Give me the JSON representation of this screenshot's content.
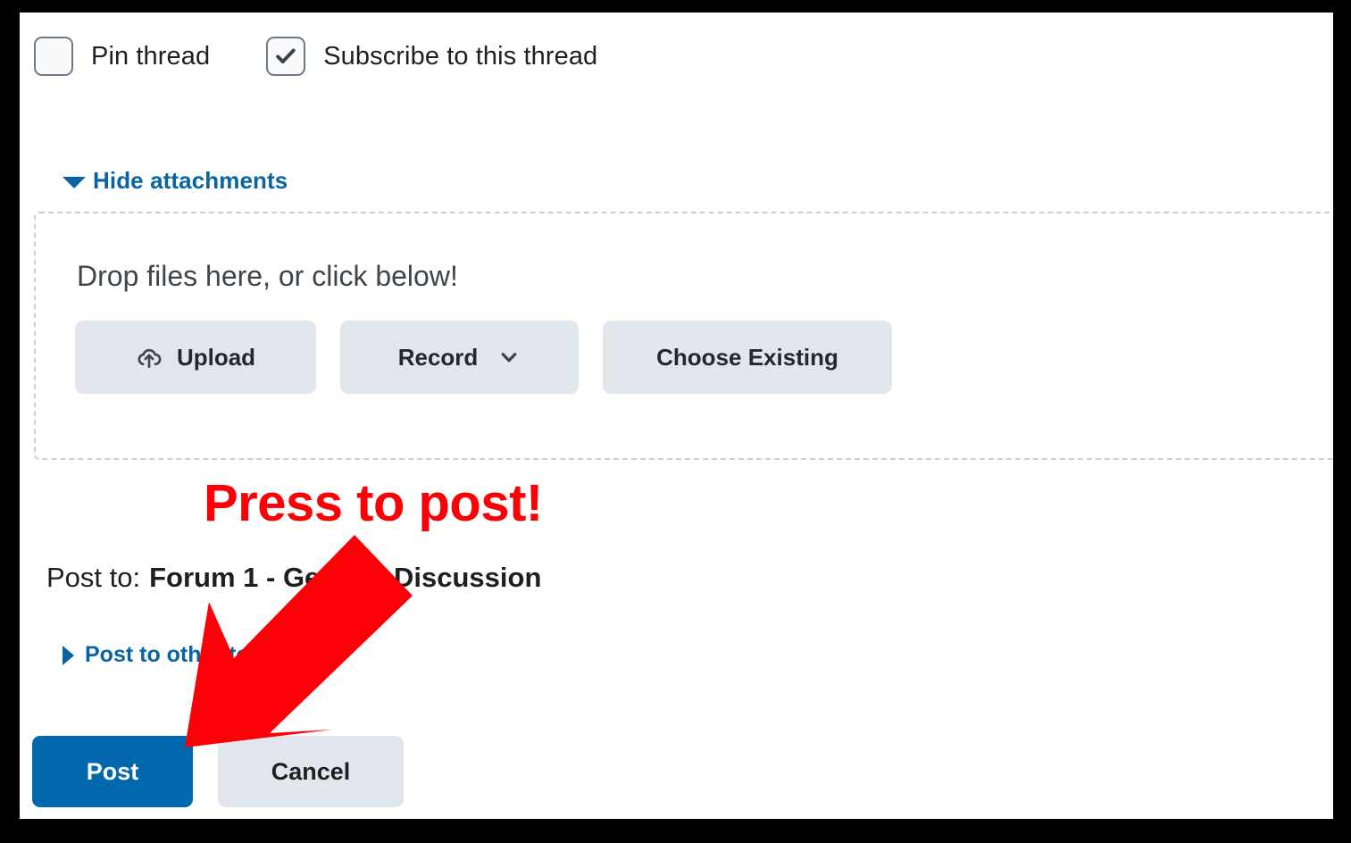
{
  "options": {
    "items": [
      {
        "label": "Pin thread",
        "checked": false,
        "icon": "checkbox-icon"
      },
      {
        "label": "Subscribe to this thread",
        "checked": true,
        "icon": "check-icon"
      }
    ]
  },
  "attachments": {
    "toggle_label": "Hide attachments",
    "toggle_icon": "triangle-down-icon",
    "dropzone_title": "Drop files here, or click below!",
    "buttons": [
      {
        "label": "Upload",
        "icon": "cloud-upload-icon"
      },
      {
        "label": "Record",
        "icon": "chevron-down-icon"
      },
      {
        "label": "Choose Existing",
        "icon": ""
      }
    ]
  },
  "post_target": {
    "prefix": "Post to:",
    "forum_name": "Forum 1 - General Discussion",
    "other_topics_label": "Post to other topics",
    "other_topics_icon": "triangle-right-icon"
  },
  "actions": {
    "post_label": "Post",
    "cancel_label": "Cancel"
  },
  "annotation": {
    "text": "Press to post!",
    "icon": "arrow-down-left-icon",
    "color": "#fb0007"
  },
  "colors": {
    "accent_blue": "#0a64a4",
    "primary_button": "#0268ae",
    "neutral_button": "#e2e7ee",
    "dropzone_border": "#c8d1da",
    "annotation_red": "#fb0007",
    "frame": "#000000"
  }
}
